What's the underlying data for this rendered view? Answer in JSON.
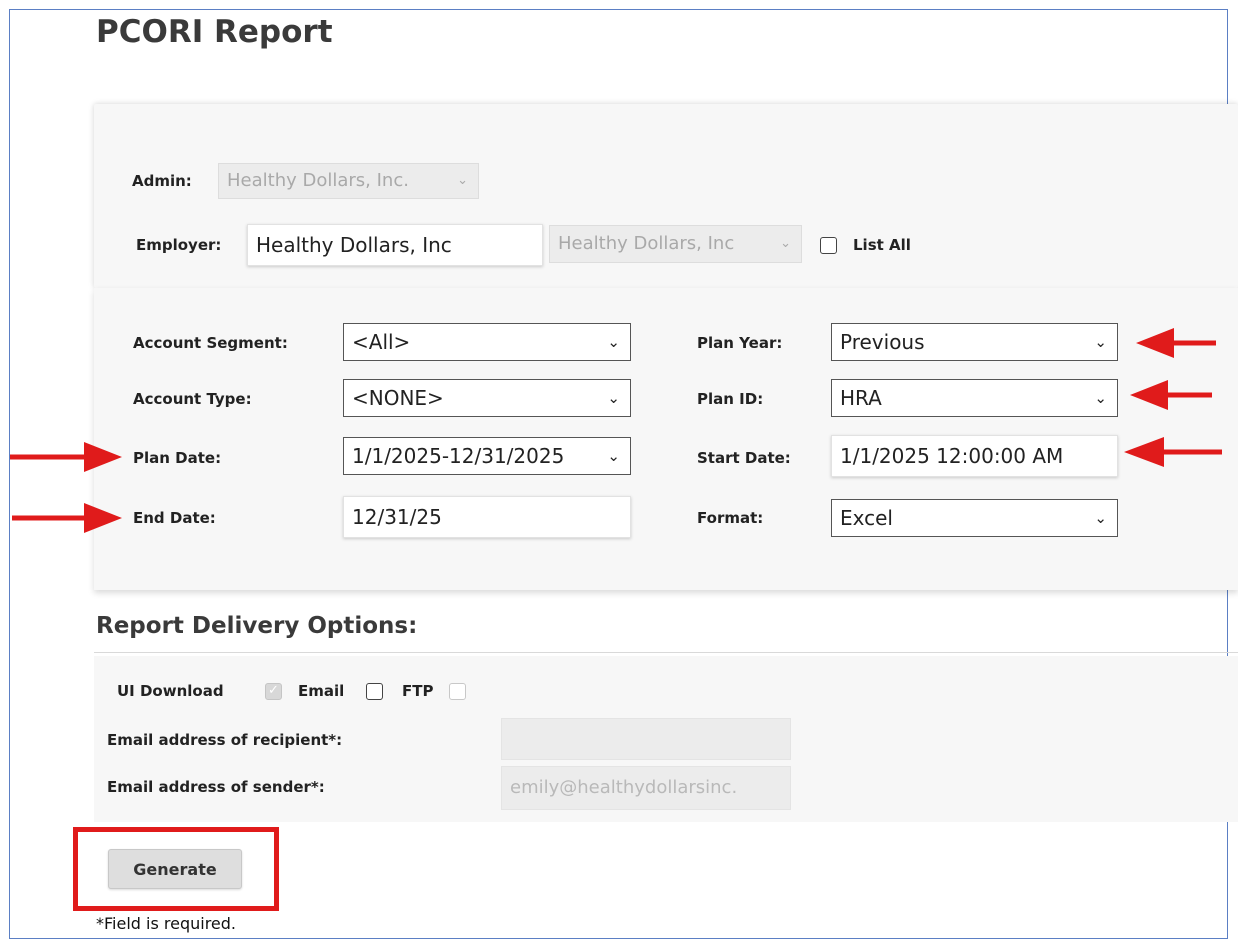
{
  "page": {
    "title": "PCORI Report"
  },
  "top_filters": {
    "admin_label": "Admin:",
    "admin_value": "Healthy Dollars, Inc.",
    "employer_label": "Employer:",
    "employer_input": "Healthy Dollars, Inc",
    "employer_select": "Healthy Dollars, Inc",
    "list_all_label": "List All"
  },
  "form": {
    "account_segment_label": "Account Segment:",
    "account_segment_value": "<All>",
    "account_type_label": "Account Type:",
    "account_type_value": "<NONE>",
    "plan_date_label": "Plan Date:",
    "plan_date_value": "1/1/2025-12/31/2025",
    "end_date_label": "End Date:",
    "end_date_value": "12/31/25",
    "plan_year_label": "Plan Year:",
    "plan_year_value": "Previous",
    "plan_id_label": "Plan ID:",
    "plan_id_value": "HRA",
    "start_date_label": "Start Date:",
    "start_date_value": "1/1/2025 12:00:00 AM",
    "format_label": "Format:",
    "format_value": "Excel"
  },
  "delivery": {
    "heading": "Report Delivery Options:",
    "ui_download_label": "UI Download",
    "email_label": "Email",
    "ftp_label": "FTP",
    "recipient_label": "Email address of recipient*:",
    "recipient_value": "",
    "sender_label": "Email address of sender*:",
    "sender_value": "emily@healthydollarsinc."
  },
  "actions": {
    "generate_label": "Generate"
  },
  "footer": {
    "required_note": "*Field is required."
  },
  "colors": {
    "annotation_red": "#e01b1b",
    "frame_blue": "#5b7fc4"
  }
}
